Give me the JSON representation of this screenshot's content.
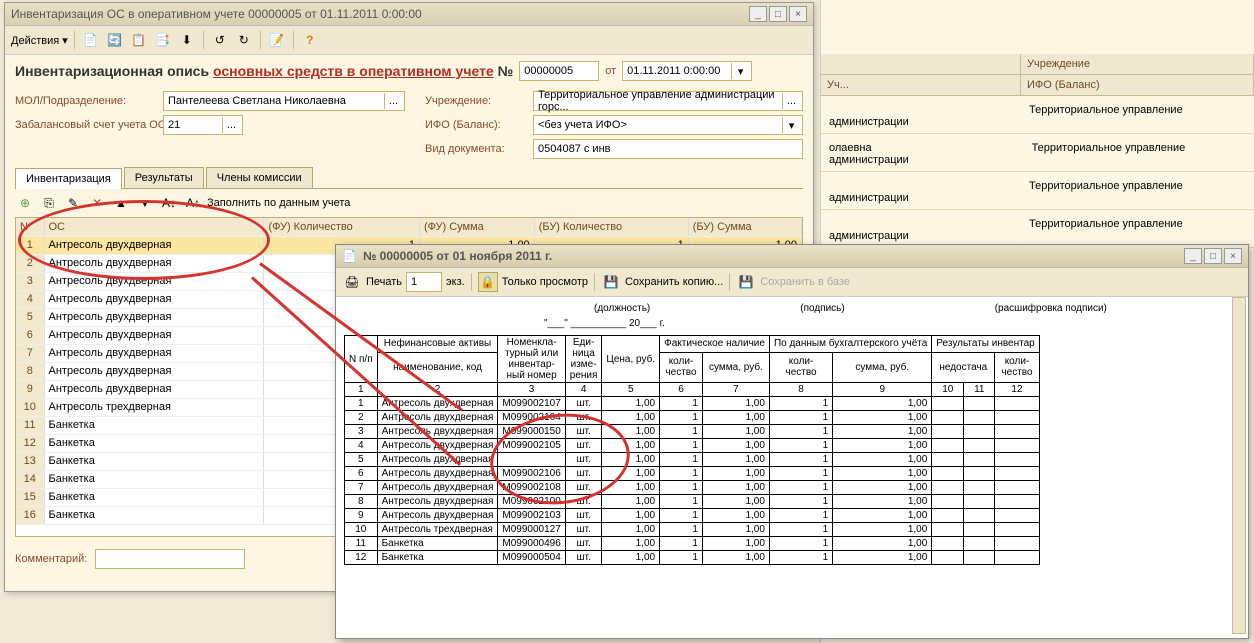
{
  "main": {
    "title": "Инвентаризация ОС в оперативном учете 00000005 от 01.11.2011 0:00:00",
    "actions_label": "Действия",
    "big_title_prefix": "Инвентаризационная опись ",
    "big_title_underline": "основных средств в оперативном учете",
    "big_title_suffix": " №",
    "number": "00000005",
    "from_label": "от",
    "date": "01.11.2011 0:00:00",
    "mol_label": "МОЛ/Подразделение:",
    "mol_value": "Пантелеева Светлана Николаевна",
    "offbal_label": "Забалансовый счет учета ОС:",
    "offbal_value": "21",
    "org_label": "Учреждение:",
    "org_value": "Территориальное управление администрации горс...",
    "ifo_label": "ИФО (Баланс):",
    "ifo_value": "<без учета ИФО>",
    "docview_label": "Вид документа:",
    "docview_value": "0504087 с инв",
    "tabs": [
      "Инвентаризация",
      "Результаты",
      "Члены комиссии"
    ],
    "fill_label": "Заполнить по данным учета",
    "grid_headers": [
      "N",
      "ОС",
      "(ФУ) Количество",
      "(ФУ) Сумма",
      "(БУ) Количество",
      "(БУ) Сумма"
    ],
    "rows": [
      {
        "n": 1,
        "os": "Антресоль двухдверная",
        "fu_qty": "1",
        "fu_sum": "1,00",
        "bu_qty": "1",
        "bu_sum": "1,00"
      },
      {
        "n": 2,
        "os": "Антресоль двухдверная"
      },
      {
        "n": 3,
        "os": "Антресоль двухдверная"
      },
      {
        "n": 4,
        "os": "Антресоль двухдверная"
      },
      {
        "n": 5,
        "os": "Антресоль двухдверная"
      },
      {
        "n": 6,
        "os": "Антресоль двухдверная"
      },
      {
        "n": 7,
        "os": "Антресоль двухдверная"
      },
      {
        "n": 8,
        "os": "Антресоль двухдверная"
      },
      {
        "n": 9,
        "os": "Антресоль двухдверная"
      },
      {
        "n": 10,
        "os": "Антресоль трехдверная"
      },
      {
        "n": 11,
        "os": "Банкетка"
      },
      {
        "n": 12,
        "os": "Банкетка"
      },
      {
        "n": 13,
        "os": "Банкетка"
      },
      {
        "n": 14,
        "os": "Банкетка"
      },
      {
        "n": 15,
        "os": "Банкетка"
      },
      {
        "n": 16,
        "os": "Банкетка"
      }
    ],
    "comment_label": "Комментарий:"
  },
  "right": {
    "col2": "Учреждение",
    "sub1": "Уч...",
    "sub2": "ИФО (Баланс)",
    "row_text": "Территориальное управление администрации",
    "mid_text": "олаевна"
  },
  "preview": {
    "title": "№ 00000005 от 01 ноября 2011 г.",
    "print_label": "Печать",
    "copies": "1",
    "copies_suffix": "экз.",
    "view_only": "Только просмотр",
    "save_copy": "Сохранить копию...",
    "save_base": "Сохранить в базе",
    "hdr_post": "(должность)",
    "hdr_sign": "(подпись)",
    "hdr_decode": "(расшифровка подписи)",
    "hdr_year_prefix": "20",
    "hdr_year_suffix": "г.",
    "headers": {
      "npl": "N п/п",
      "nfa": "Нефинансовые активы",
      "nfa_sub": "наименование, код",
      "nom": "Номенкла-\nтурный или\nинвентар-\nный номер",
      "unit": "Еди-\nница\nизме-\nрения",
      "price": "Цена, руб.",
      "fact": "Фактическое наличие",
      "acct": "По данным бухгалтерского учёта",
      "res": "Результаты инвентар",
      "short": "недостача",
      "qty": "коли-\nчество",
      "sum": "сумма, руб."
    },
    "colnums": [
      "1",
      "2",
      "3",
      "4",
      "5",
      "6",
      "7",
      "8",
      "9",
      "10",
      "11",
      "12"
    ],
    "rows": [
      {
        "n": 1,
        "name": "Антресоль двухдверная",
        "nom": "М099002107",
        "u": "шт.",
        "p": "1,00",
        "fq": "1",
        "fs": "1,00",
        "aq": "1",
        "as": "1,00"
      },
      {
        "n": 2,
        "name": "Антресоль двухдверная",
        "nom": "М099002104",
        "u": "шт.",
        "p": "1,00",
        "fq": "1",
        "fs": "1,00",
        "aq": "1",
        "as": "1,00"
      },
      {
        "n": 3,
        "name": "Антресоль двухдверная",
        "nom": "М099000150",
        "u": "шт.",
        "p": "1,00",
        "fq": "1",
        "fs": "1,00",
        "aq": "1",
        "as": "1,00"
      },
      {
        "n": 4,
        "name": "Антресоль двухдверная",
        "nom": "М099002105",
        "u": "шт.",
        "p": "1,00",
        "fq": "1",
        "fs": "1,00",
        "aq": "1",
        "as": "1,00"
      },
      {
        "n": 5,
        "name": "Антресоль двухдверная",
        "nom": "",
        "u": "шт.",
        "p": "1,00",
        "fq": "1",
        "fs": "1,00",
        "aq": "1",
        "as": "1,00"
      },
      {
        "n": 6,
        "name": "Антресоль двухдверная",
        "nom": "М099002106",
        "u": "шт.",
        "p": "1,00",
        "fq": "1",
        "fs": "1,00",
        "aq": "1",
        "as": "1,00"
      },
      {
        "n": 7,
        "name": "Антресоль двухдверная",
        "nom": "М099002108",
        "u": "шт.",
        "p": "1,00",
        "fq": "1",
        "fs": "1,00",
        "aq": "1",
        "as": "1,00"
      },
      {
        "n": 8,
        "name": "Антресоль двухдверная",
        "nom": "М099002100",
        "u": "шт.",
        "p": "1,00",
        "fq": "1",
        "fs": "1,00",
        "aq": "1",
        "as": "1,00"
      },
      {
        "n": 9,
        "name": "Антресоль двухдверная",
        "nom": "М099002103",
        "u": "шт.",
        "p": "1,00",
        "fq": "1",
        "fs": "1,00",
        "aq": "1",
        "as": "1,00"
      },
      {
        "n": 10,
        "name": "Антресоль трехдверная",
        "nom": "М099000127",
        "u": "шт.",
        "p": "1,00",
        "fq": "1",
        "fs": "1,00",
        "aq": "1",
        "as": "1,00"
      },
      {
        "n": 11,
        "name": "Банкетка",
        "nom": "М099000496",
        "u": "шт.",
        "p": "1,00",
        "fq": "1",
        "fs": "1,00",
        "aq": "1",
        "as": "1,00"
      },
      {
        "n": 12,
        "name": "Банкетка",
        "nom": "М099000504",
        "u": "шт.",
        "p": "1,00",
        "fq": "1",
        "fs": "1,00",
        "aq": "1",
        "as": "1,00"
      }
    ]
  }
}
